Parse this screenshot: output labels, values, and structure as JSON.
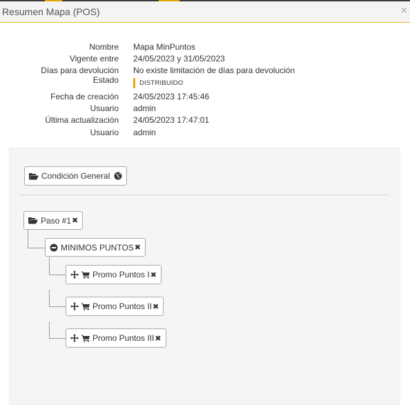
{
  "window": {
    "title": "Resumen Mapa (POS)",
    "close_glyph": "×",
    "accent_color": "#e8b923"
  },
  "info": {
    "rows": [
      {
        "label": "Nombre",
        "value": "Mapa MinPuntos"
      },
      {
        "label": "Vigente entre",
        "value": "24/05/2023 y 31/05/2023"
      },
      {
        "label": "Días para devolución",
        "value": "No existe limitación de días para devolución"
      },
      {
        "label": "Estado",
        "value": "DISTRIBUIDO"
      },
      {
        "label": "Fecha de creación",
        "value": "24/05/2023 17:45:46"
      },
      {
        "label": "Usuario",
        "value": "admin"
      },
      {
        "label": "Última actualización",
        "value": "24/05/2023 17:47:01"
      },
      {
        "label": "Usuario",
        "value": "admin"
      }
    ],
    "status_color": "#f0a30a"
  },
  "tree": {
    "general": {
      "label": "Condición General",
      "icons": [
        "folder-open-icon",
        "globe-icon"
      ]
    },
    "step": {
      "label": "Paso #1",
      "remove_glyph": "✖"
    },
    "group": {
      "label": "MINIMOS PUNTOS",
      "remove_glyph": "✖"
    },
    "promos": [
      {
        "label": "Promo Puntos I",
        "remove_glyph": "✖"
      },
      {
        "label": "Promo Puntos II",
        "remove_glyph": "✖"
      },
      {
        "label": "Promo Puntos III",
        "remove_glyph": "✖"
      }
    ],
    "promo_icons": [
      "move-icon",
      "cart-icon"
    ]
  }
}
